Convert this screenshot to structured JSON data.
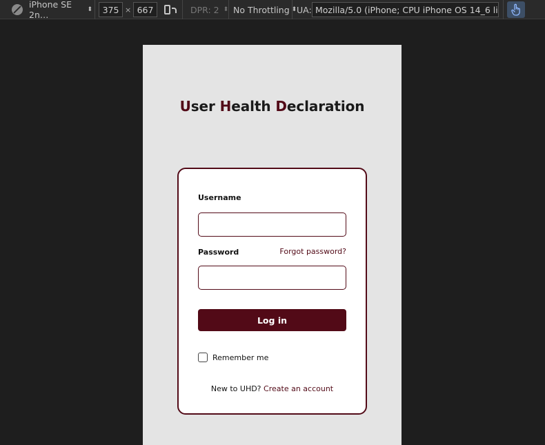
{
  "devtools": {
    "device": "iPhone SE 2n…",
    "width": "375",
    "times": "×",
    "height": "667",
    "dpr": "DPR: 2",
    "throttling": "No Throttling",
    "ua_label": "UA:",
    "ua_value": "Mozilla/5.0 (iPhone; CPU iPhone OS 14_6 like Mac",
    "icons": [
      "blocked-circle-icon",
      "caret-icon",
      "rotate-device-icon",
      "touch-hand-icon"
    ],
    "accent": "#3d4f66"
  },
  "page": {
    "title_parts": [
      {
        "initial": "U",
        "rest": "ser "
      },
      {
        "initial": "H",
        "rest": "ealth "
      },
      {
        "initial": "D",
        "rest": "eclaration"
      }
    ],
    "accent": "#520a17"
  },
  "form": {
    "username_label": "Username",
    "username_value": "",
    "password_label": "Password",
    "password_value": "",
    "forgot_label": "Forgot password?",
    "login_label": "Log in",
    "remember_label": "Remember me",
    "remember_checked": false,
    "signup_prompt": "New to UHD?",
    "signup_link": "Create an account"
  }
}
